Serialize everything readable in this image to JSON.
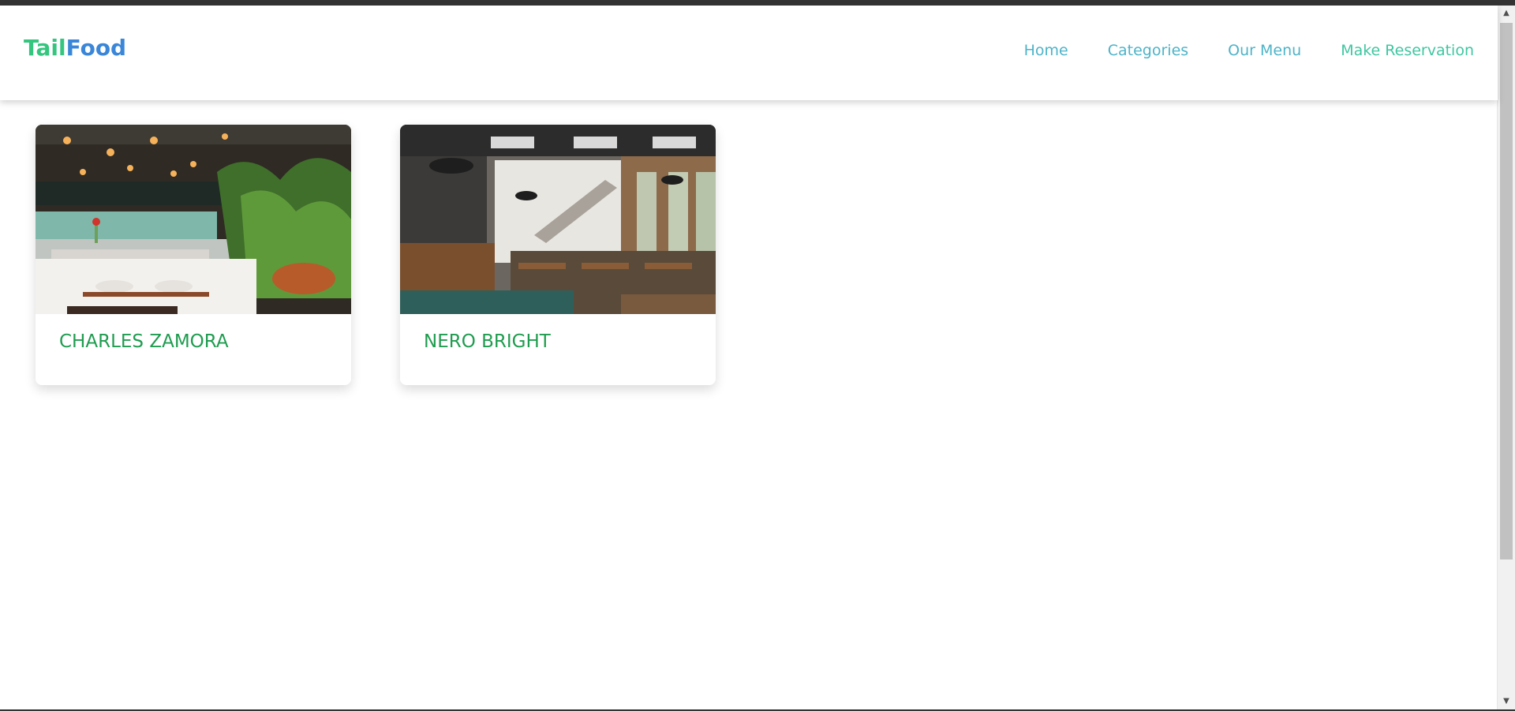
{
  "header": {
    "logo_part1": "Tail",
    "logo_part2": "Food",
    "nav": [
      {
        "label": "Home"
      },
      {
        "label": "Categories"
      },
      {
        "label": "Our Menu"
      },
      {
        "label": "Make Reservation"
      }
    ]
  },
  "restaurants": [
    {
      "name": "CHARLES ZAMORA",
      "image": "restaurant-interior-photo"
    },
    {
      "name": "NERO BRIGHT",
      "image": "cafe-interior-photo"
    }
  ],
  "colors": {
    "brand_green": "#34c57e",
    "brand_blue": "#3a86d8",
    "card_title": "#1f9c4f",
    "nav_link": "#4db3c8"
  }
}
